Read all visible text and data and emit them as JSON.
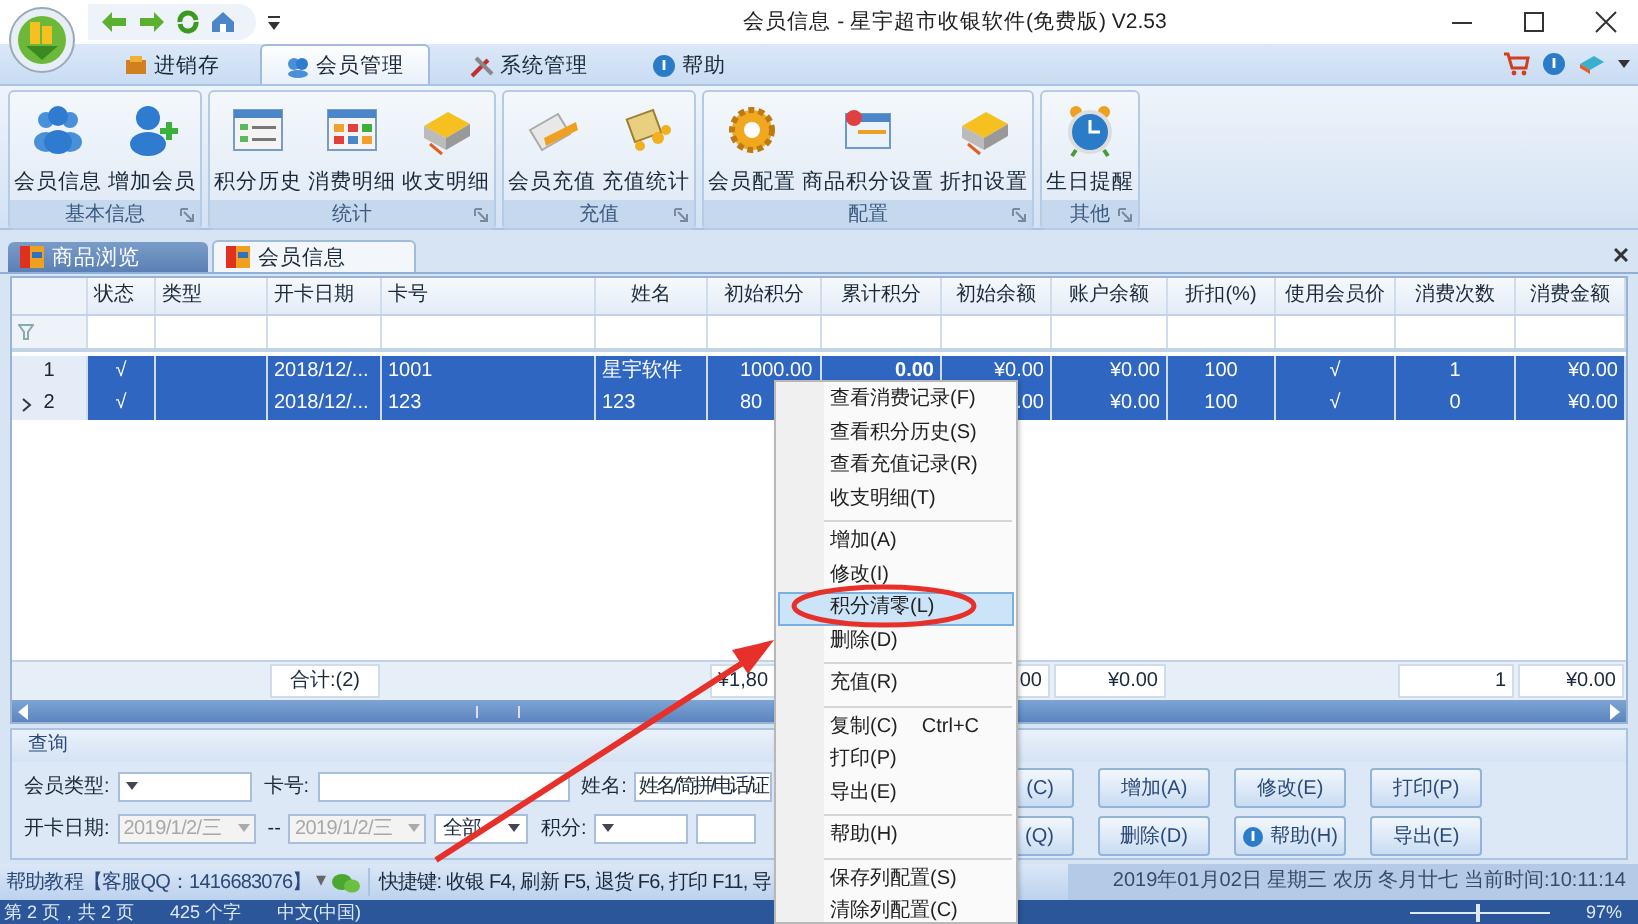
{
  "window": {
    "title": "会员信息 - 星宇超市收银软件(免费版) V2.53"
  },
  "ribbon_tabs": [
    {
      "label": "进销存",
      "selected": false
    },
    {
      "label": "会员管理",
      "selected": true
    },
    {
      "label": "系统管理",
      "selected": false
    },
    {
      "label": "帮助",
      "selected": false
    }
  ],
  "ribbon_groups": [
    {
      "title": "基本信息",
      "buttons": [
        {
          "label": "会员信息",
          "kind": "people"
        },
        {
          "label": "增加会员",
          "kind": "addperson"
        }
      ]
    },
    {
      "title": "统计",
      "buttons": [
        {
          "label": "积分历史",
          "kind": "list"
        },
        {
          "label": "消费明细",
          "kind": "grid"
        },
        {
          "label": "收支明细",
          "kind": "book"
        }
      ]
    },
    {
      "title": "充值",
      "buttons": [
        {
          "label": "会员充值",
          "kind": "card"
        },
        {
          "label": "充值统计",
          "kind": "coins"
        }
      ]
    },
    {
      "title": "配置",
      "buttons": [
        {
          "label": "会员配置",
          "kind": "gear"
        },
        {
          "label": "商品积分设置",
          "kind": "window"
        },
        {
          "label": "折扣设置",
          "kind": "book"
        }
      ]
    },
    {
      "title": "其他",
      "buttons": [
        {
          "label": "生日提醒",
          "kind": "alarm"
        }
      ]
    }
  ],
  "doc_tabs": [
    {
      "label": "商品浏览",
      "selected": false
    },
    {
      "label": "会员信息",
      "selected": true
    }
  ],
  "table": {
    "columns": [
      {},
      {
        "header": "状态"
      },
      {
        "header": "类型"
      },
      {
        "header": "开卡日期",
        "total": "合计:(2)"
      },
      {
        "header": "卡号"
      },
      {
        "header": "姓名"
      },
      {
        "header": "初始积分",
        "total": "¥1,80"
      },
      {
        "header": "累计积分"
      },
      {
        "header": "初始余额",
        "total": ".00"
      },
      {
        "header": "账户余额",
        "total": "¥0.00"
      },
      {
        "header": "折扣(%)"
      },
      {
        "header": "使用会员价"
      },
      {
        "header": "消费次数",
        "total": "1"
      },
      {
        "header": "消费金额",
        "total": "¥0.00"
      }
    ],
    "rows": [
      {
        "selected": true,
        "current": false,
        "cells": [
          "1",
          "√",
          "",
          "2018/12/...",
          "1001",
          "星宇软件",
          "1000.00",
          "0.00",
          "¥0.00",
          "¥0.00",
          "100",
          "√",
          "1",
          "¥0.00"
        ]
      },
      {
        "selected": true,
        "current": true,
        "cells": [
          "2",
          "√",
          "",
          "2018/12/...",
          "123",
          "123",
          "80",
          "",
          ".00",
          "¥0.00",
          "100",
          "√",
          "0",
          "¥0.00"
        ]
      }
    ]
  },
  "query": {
    "title": "查询",
    "rows": [
      {
        "fields": [
          {
            "label": "会员类型:",
            "kind": "combo"
          },
          {
            "label": "卡号:",
            "kind": "input"
          },
          {
            "label": "姓名:",
            "kind": "input",
            "value": "姓名/简拼/电话/证"
          }
        ]
      },
      {
        "fields": [
          {
            "label": "开卡日期:",
            "kind": "date",
            "value": "2019/1/2/三",
            "disabled": true
          },
          {
            "kind": "dash",
            "text": "--"
          },
          {
            "kind": "date",
            "value": "2019/1/2/三",
            "disabled": true
          },
          {
            "kind": "combo",
            "value": "全部"
          },
          {
            "label": "积分:",
            "kind": "combo"
          },
          {
            "kind": "input"
          }
        ]
      }
    ],
    "buttons": [
      {
        "label": "(C)"
      },
      {
        "label": "增加(A)"
      },
      {
        "label": "修改(E)"
      },
      {
        "label": "打印(P)"
      },
      {
        "label": "(Q)"
      },
      {
        "label": "删除(D)"
      },
      {
        "label": "帮助(H)",
        "has_icon": true
      },
      {
        "label": "导出(E)"
      }
    ]
  },
  "status_bar": {
    "help": "帮助教程【客服QQ：1416683076】",
    "help_caret": "▾",
    "shortcuts": "快捷键: 收银 F4, 刷新 F5, 退货 F6, 打印 F11, 导",
    "datetime": "2019年01月02日 星期三 农历 冬月廿七 当前时间:10:11:14"
  },
  "background_status": {
    "texts": [
      "第 2 页，共 2 页",
      "425 个字",
      "中文(中国)"
    ],
    "zoom": "97%",
    "level": 0.47
  },
  "context_menu": {
    "items": [
      {
        "kind": "item",
        "label": "查看消费记录(F)",
        "selected": false
      },
      {
        "kind": "item",
        "label": "查看积分历史(S)",
        "selected": false
      },
      {
        "kind": "item",
        "label": "查看充值记录(R)",
        "selected": false
      },
      {
        "kind": "item",
        "label": "收支明细(T)",
        "selected": false
      },
      {
        "kind": "separator"
      },
      {
        "kind": "item",
        "label": "增加(A)",
        "selected": false
      },
      {
        "kind": "item",
        "label": "修改(I)",
        "selected": false
      },
      {
        "kind": "item",
        "label": "积分清零(L)",
        "selected": true
      },
      {
        "kind": "item",
        "label": "删除(D)",
        "selected": false
      },
      {
        "kind": "separator"
      },
      {
        "kind": "item",
        "label": "充值(R)",
        "selected": false
      },
      {
        "kind": "separator"
      },
      {
        "kind": "item",
        "label": "复制(C)",
        "shortcut": "Ctrl+C",
        "selected": false
      },
      {
        "kind": "item",
        "label": "打印(P)",
        "selected": false
      },
      {
        "kind": "item",
        "label": "导出(E)",
        "selected": false
      },
      {
        "kind": "separator"
      },
      {
        "kind": "item",
        "label": "帮助(H)",
        "selected": false
      },
      {
        "kind": "separator"
      },
      {
        "kind": "item",
        "label": "保存列配置(S)",
        "selected": false
      },
      {
        "kind": "item",
        "label": "清除列配置(C)",
        "selected": false
      }
    ]
  }
}
